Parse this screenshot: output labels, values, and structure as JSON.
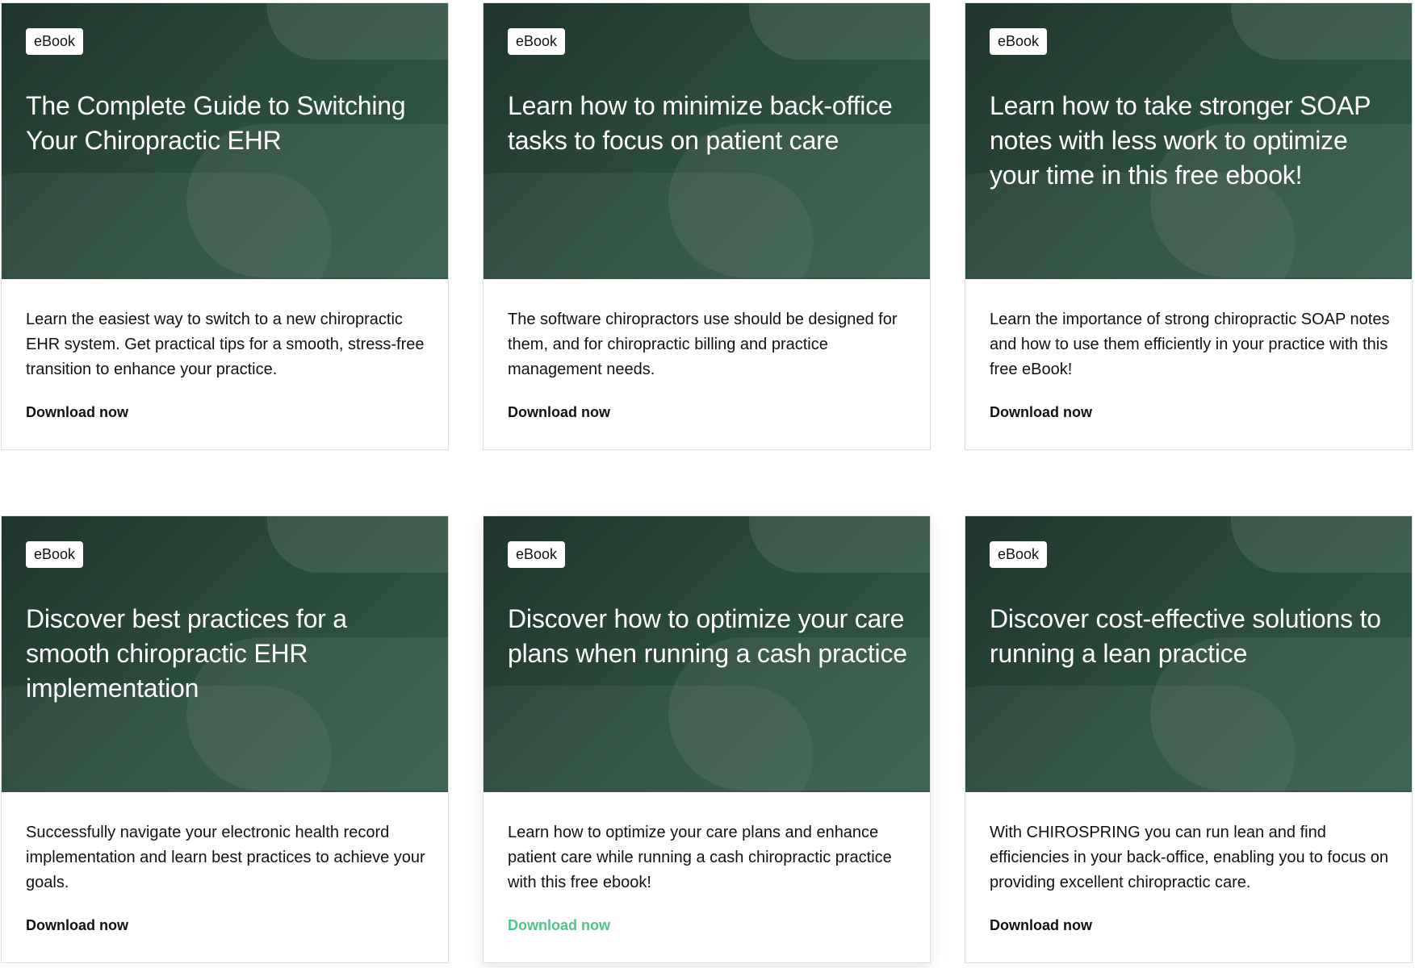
{
  "cards": [
    {
      "badge": "eBook",
      "title": "The Complete Guide to Switching Your Chiropractic EHR",
      "description": "Learn the easiest way to switch to a new chiropractic EHR system. Get practical tips for a smooth, stress-free transition to enhance your practice.",
      "cta": "Download now"
    },
    {
      "badge": "eBook",
      "title": "Learn how to minimize back-office tasks to focus on patient care",
      "description": "The software chiropractors use should be designed for them, and for chiropractic billing and practice management needs.",
      "cta": "Download now"
    },
    {
      "badge": "eBook",
      "title": "Learn how to take stronger SOAP notes with less work to optimize your time in this free ebook!",
      "description": "Learn the importance of strong chiropractic SOAP notes and how to use them efficiently in your practice with this free eBook!",
      "cta": "Download now"
    },
    {
      "badge": "eBook",
      "title": "Discover best practices for a smooth chiropractic EHR implementation",
      "description": "Successfully navigate your electronic health record implementation and learn best practices to achieve your goals.",
      "cta": "Download now"
    },
    {
      "badge": "eBook",
      "title": "Discover how to optimize your care plans when running a cash practice",
      "description": "Learn how to optimize your care plans and enhance patient care while running a cash chiropractic practice with this free ebook!",
      "cta": "Download now"
    },
    {
      "badge": "eBook",
      "title": "Discover cost-effective solutions to running a lean practice",
      "description": "With CHIROSPRING you can run lean and find efficiencies in your back-office, enabling you to focus on providing excellent chiropractic care.",
      "cta": "Download now"
    }
  ],
  "colors": {
    "hero_dark": "#1f362c",
    "hero_light": "#3d6653",
    "cta_active": "#52c28d",
    "text": "#111111"
  }
}
